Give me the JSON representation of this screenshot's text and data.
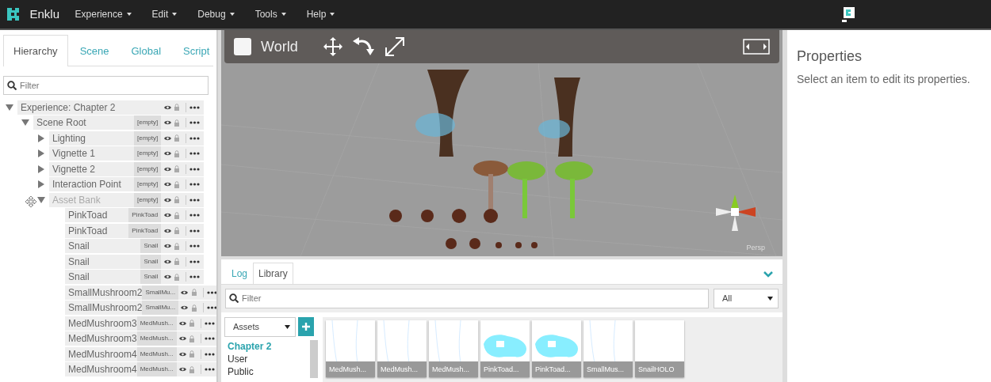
{
  "navbar": {
    "brand": "Enklu",
    "menus": [
      "Experience",
      "Edit",
      "Debug",
      "Tools",
      "Help"
    ]
  },
  "left_panel": {
    "tabs": [
      {
        "label": "Hierarchy",
        "selected": true
      },
      {
        "label": "Scene",
        "selected": false
      },
      {
        "label": "Global",
        "selected": false
      },
      {
        "label": "Script",
        "selected": false
      }
    ],
    "filter": {
      "placeholder": "Filter"
    },
    "tree": [
      {
        "name": "Experience: Chapter 2",
        "expanded": true,
        "dragging": false,
        "children": [
          {
            "name": "Scene Root",
            "tag": "[empty]",
            "expanded": true,
            "dragging": false,
            "children": [
              {
                "name": "Lighting",
                "tag": "[empty]",
                "expanded": false,
                "dragging": false
              },
              {
                "name": "Vignette 1",
                "tag": "[empty]",
                "expanded": false,
                "dragging": false
              },
              {
                "name": "Vignette 2",
                "tag": "[empty]",
                "expanded": false,
                "dragging": false
              },
              {
                "name": "Interaction Point",
                "tag": "[empty]",
                "expanded": false,
                "dragging": false
              },
              {
                "name": "Asset Bank",
                "tag": "[empty]",
                "expanded": true,
                "dragging": true,
                "children": [
                  {
                    "name": "PinkToad",
                    "tag": "PinkToad",
                    "dragging": false
                  },
                  {
                    "name": "PinkToad",
                    "tag": "PinkToad",
                    "dragging": false
                  },
                  {
                    "name": "Snail",
                    "tag": "Snail",
                    "dragging": false
                  },
                  {
                    "name": "Snail",
                    "tag": "Snail",
                    "dragging": false
                  },
                  {
                    "name": "Snail",
                    "tag": "Snail",
                    "dragging": false
                  },
                  {
                    "name": "SmallMushroom2",
                    "tag": "SmallMu...",
                    "dragging": false
                  },
                  {
                    "name": "SmallMushroom2",
                    "tag": "SmallMu...",
                    "dragging": false
                  },
                  {
                    "name": "MedMushroom3",
                    "tag": "MedMush...",
                    "dragging": false
                  },
                  {
                    "name": "MedMushroom3",
                    "tag": "MedMush...",
                    "dragging": false
                  },
                  {
                    "name": "MedMushroom4",
                    "tag": "MedMush...",
                    "dragging": false
                  },
                  {
                    "name": "MedMushroom4",
                    "tag": "MedMush...",
                    "dragging": false
                  }
                ]
              }
            ]
          }
        ]
      }
    ]
  },
  "viewport": {
    "toolbar": {
      "world_label": "World",
      "world_checked": false
    },
    "camera_label": "Persp"
  },
  "bottom_panel": {
    "tabs": [
      {
        "label": "Log",
        "selected": false
      },
      {
        "label": "Library",
        "selected": true
      }
    ],
    "filter": {
      "placeholder": "Filter"
    },
    "type_select": "All",
    "source_select": "Assets",
    "folders": [
      {
        "label": "Chapter 2",
        "selected": true
      },
      {
        "label": "User",
        "selected": false
      },
      {
        "label": "Public",
        "selected": false
      }
    ],
    "assets": [
      {
        "label": "MedMush...",
        "kind": "lines"
      },
      {
        "label": "MedMush...",
        "kind": "lines"
      },
      {
        "label": "MedMush...",
        "kind": "lines"
      },
      {
        "label": "PinkToad...",
        "kind": "toad"
      },
      {
        "label": "PinkToad...",
        "kind": "toad"
      },
      {
        "label": "SmallMus...",
        "kind": "lines"
      },
      {
        "label": "SnailHOLO",
        "kind": "blank"
      }
    ]
  },
  "properties": {
    "title": "Properties",
    "hint": "Select an item to edit its properties."
  }
}
